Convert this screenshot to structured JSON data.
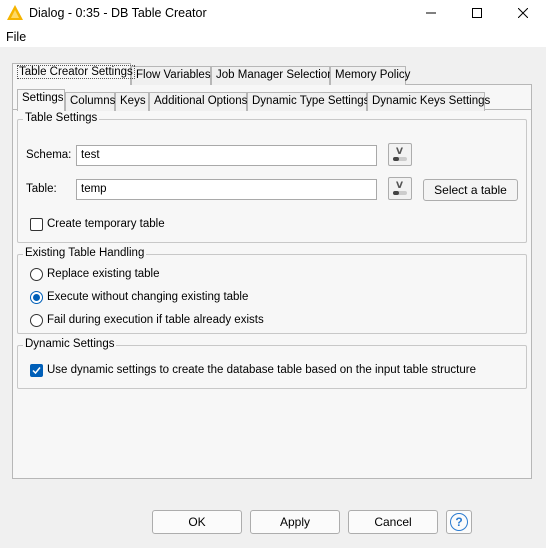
{
  "window": {
    "title": "Dialog - 0:35 - DB Table Creator"
  },
  "menu": {
    "file": "File"
  },
  "outer_tabs": [
    "Table Creator Settings",
    "Flow Variables",
    "Job Manager Selection",
    "Memory Policy"
  ],
  "inner_tabs": [
    "Settings",
    "Columns",
    "Keys",
    "Additional Options",
    "Dynamic Type Settings",
    "Dynamic Keys Settings"
  ],
  "table_settings": {
    "legend": "Table Settings",
    "schema_label": "Schema:",
    "schema_value": "test",
    "table_label": "Table:",
    "table_value": "temp",
    "select_table_button": "Select a table",
    "temporary_label": "Create temporary table",
    "temporary_checked": false
  },
  "existing_table_handling": {
    "legend": "Existing Table Handling",
    "options": [
      "Replace existing table",
      "Execute without changing existing table",
      "Fail during execution if table already exists"
    ],
    "selected": "Execute without changing existing table"
  },
  "dynamic_settings": {
    "legend": "Dynamic Settings",
    "dynamic_label": "Use dynamic settings to create the database table based on the input table structure",
    "dynamic_checked": true
  },
  "buttons": {
    "ok": "OK",
    "apply": "Apply",
    "cancel": "Cancel",
    "help_icon": "?"
  },
  "colors": {
    "accent": "#005fb8",
    "app_icon": "#f5b400"
  }
}
